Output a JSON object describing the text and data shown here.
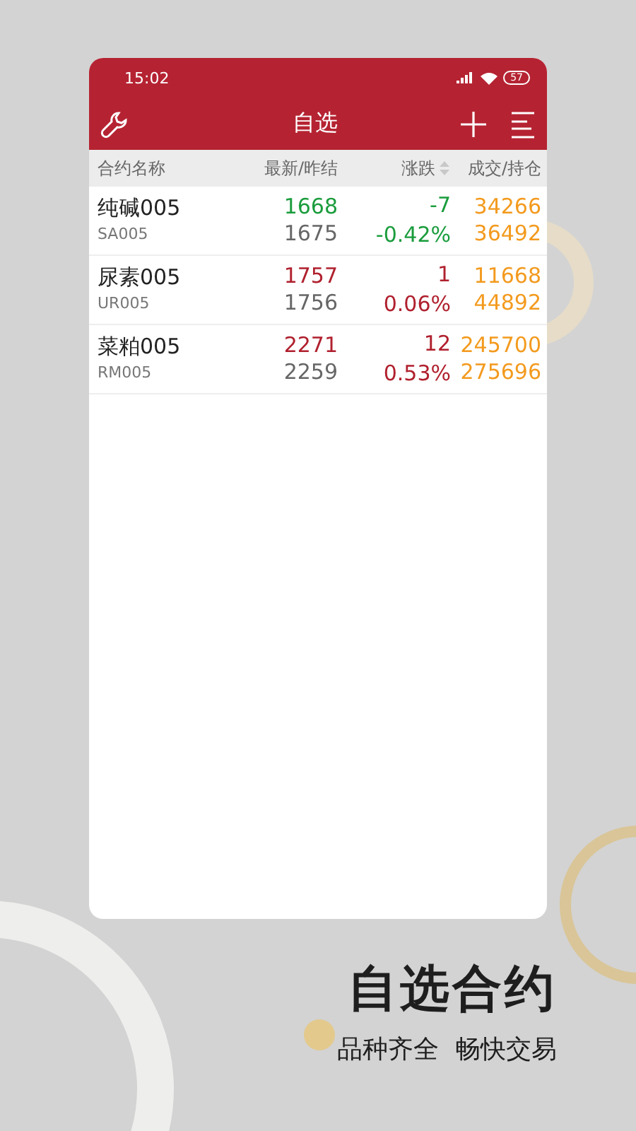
{
  "status_bar": {
    "time": "15:02",
    "battery": "57"
  },
  "nav_bar": {
    "title": "自选"
  },
  "table": {
    "columns": [
      "合约名称",
      "最新/昨结",
      "涨跌",
      "成交/持仓"
    ],
    "rows": [
      {
        "name": "纯碱005",
        "code": "SA005",
        "last": "1668",
        "prev": "1675",
        "change": "-7",
        "change_pct": "-0.42%",
        "volume": "34266",
        "open_interest": "36492",
        "rising": false
      },
      {
        "name": "尿素005",
        "code": "UR005",
        "last": "1757",
        "prev": "1756",
        "change": "1",
        "change_pct": "0.06%",
        "volume": "11668",
        "open_interest": "44892",
        "rising": true
      },
      {
        "name": "菜粕005",
        "code": "RM005",
        "last": "2271",
        "prev": "2259",
        "change": "12",
        "change_pct": "0.53%",
        "volume": "245700",
        "open_interest": "275696",
        "rising": true
      }
    ]
  },
  "promo": {
    "headline": "自选合约",
    "tagline": "品种齐全  畅快交易"
  }
}
